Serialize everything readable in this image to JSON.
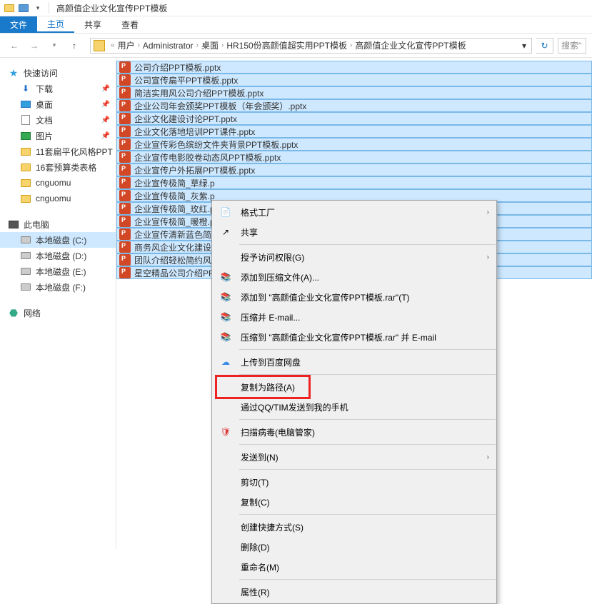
{
  "window": {
    "title": "高颜值企业文化宣传PPT模板"
  },
  "ribbon": {
    "file": "文件",
    "home": "主页",
    "share": "共享",
    "view": "查看"
  },
  "breadcrumb": {
    "prefix": "«",
    "items": [
      "用户",
      "Administrator",
      "桌面",
      "HR150份高颜值超实用PPT模板",
      "高颜值企业文化宣传PPT模板"
    ]
  },
  "search": {
    "placeholder": "搜索\""
  },
  "sidebar": {
    "quick_access": "快速访问",
    "downloads": "下载",
    "desktop": "桌面",
    "documents": "文档",
    "pictures": "图片",
    "f1": "11套扁平化风格PPT",
    "f2": "16套预算类表格",
    "f3": "cnguomu",
    "f4": "cnguomu",
    "this_pc": "此电脑",
    "disk_c": "本地磁盘 (C:)",
    "disk_d": "本地磁盘 (D:)",
    "disk_e": "本地磁盘 (E:)",
    "disk_f": "本地磁盘 (F:)",
    "network": "网络"
  },
  "files": [
    "公司介绍PPT模板.pptx",
    "公司宣传扁平PPT模板.pptx",
    "简洁实用风公司介绍PPT模板.pptx",
    "企业公司年会颁奖PPT模板（年会颁奖）.pptx",
    "企业文化建设讨论PPT.pptx",
    "企业文化落地培训PPT课件.pptx",
    "企业宣传彩色缤纷文件夹背景PPT模板.pptx",
    "企业宣传电影胶卷动态风PPT模板.pptx",
    "企业宣传户外拓展PPT模板.pptx",
    "企业宣传极简_草绿.p",
    "企业宣传极简_灰紫.p",
    "企业宣传极简_玫红.p",
    "企业宣传极简_暖橙.p",
    "企业宣传清新蓝色简洁",
    "商务风企业文化建设约",
    "团队介绍轻松简约风格",
    "星空精品公司介绍PPT"
  ],
  "context_menu": {
    "format_factory": "格式工厂",
    "share": "共享",
    "grant_access": "授予访问权限(G)",
    "add_to_archive": "添加到压缩文件(A)...",
    "add_to_named": "添加到 \"高颜值企业文化宣传PPT模板.rar\"(T)",
    "compress_email": "压缩并 E-mail...",
    "compress_named_email": "压缩到 \"高颜值企业文化宣传PPT模板.rar\" 并 E-mail",
    "upload_baidu": "上传到百度网盘",
    "copy_path": "复制为路径(A)",
    "send_qq": "通过QQ/TIM发送到我的手机",
    "scan_virus": "扫描病毒(电脑管家)",
    "send_to": "发送到(N)",
    "cut": "剪切(T)",
    "copy": "复制(C)",
    "create_shortcut": "创建快捷方式(S)",
    "delete": "删除(D)",
    "rename": "重命名(M)",
    "properties": "属性(R)"
  }
}
